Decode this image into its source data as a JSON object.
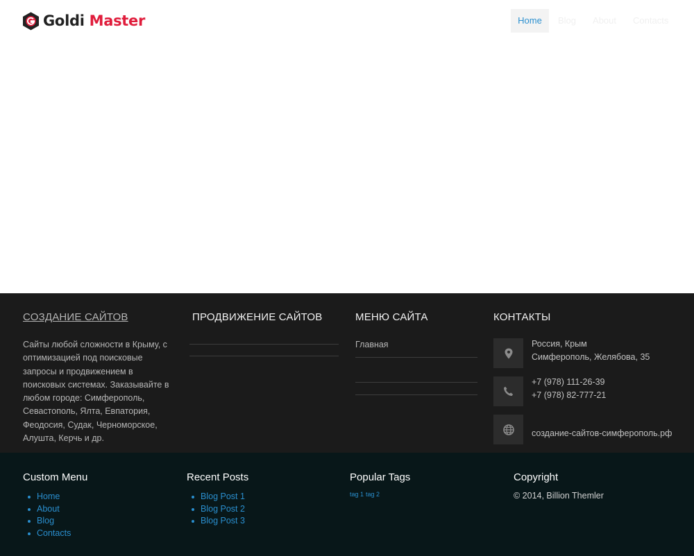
{
  "header": {
    "logo_word1": "Goldi",
    "logo_word2": "Master",
    "nav": [
      {
        "label": "Home",
        "active": true
      },
      {
        "label": "Blog"
      },
      {
        "label": "About"
      },
      {
        "label": "Contacts"
      }
    ]
  },
  "footer_top": {
    "col1": {
      "heading": "СОЗДАНИЕ САЙТОВ",
      "text": "Сайты любой сложности в Крыму, с оптимизацией под поисковые запросы и продвижением в поисковых системах. Заказывайте в любом городе: Симферополь, Севастополь, Ялта, Евпатория, Феодосия, Судак, Черноморское, Алушта, Керчь и др."
    },
    "col2": {
      "heading": "ПРОДВИЖЕНИЕ САЙТОВ"
    },
    "col3": {
      "heading": "МЕНЮ САЙТА",
      "items": [
        "Главная"
      ]
    },
    "col4": {
      "heading": "КОНТАКТЫ",
      "address_line1": "Россия, Крым",
      "address_line2": "Симферополь, Желябова, 35",
      "phone1": "+7 (978) 111-26-39",
      "phone2": "+7 (978) 82-777-21",
      "website": "создание-сайтов-симферополь.рф"
    }
  },
  "footer_bottom": {
    "custom_menu": {
      "heading": "Custom Menu",
      "items": [
        "Home",
        "About",
        "Blog",
        "Contacts"
      ]
    },
    "recent_posts": {
      "heading": "Recent Posts",
      "items": [
        "Blog Post 1",
        "Blog Post 2",
        "Blog Post 3"
      ]
    },
    "popular_tags": {
      "heading": "Popular Tags",
      "tags": [
        "tag 1",
        "tag 2"
      ]
    },
    "copyright": {
      "heading": "Copyright",
      "text": "© 2014, Billion Themler"
    }
  },
  "colors": {
    "brand_red": "#e01d3c",
    "link_blue": "#2a8fcf",
    "footer_dark": "#1b1b1b",
    "footer_bottom": "#081719"
  },
  "icons": [
    "logo-g-icon",
    "map-pin-icon",
    "phone-icon",
    "globe-icon"
  ]
}
